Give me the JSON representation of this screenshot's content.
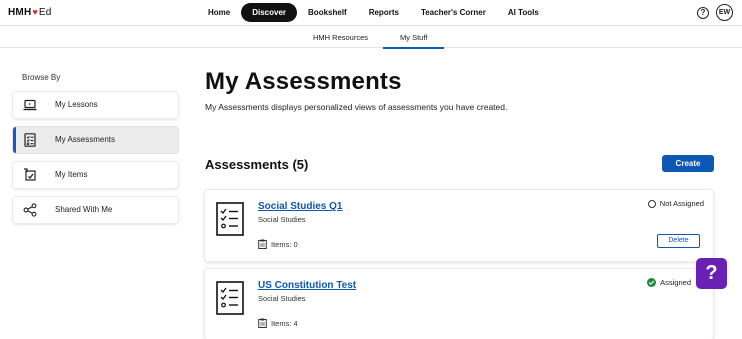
{
  "header": {
    "logo_text": "HMH",
    "logo_heart": "♥",
    "logo_suffix": "Ed",
    "nav": [
      "Home",
      "Discover",
      "Bookshelf",
      "Reports",
      "Teacher's Corner",
      "AI Tools"
    ],
    "active_nav": "Discover",
    "help_glyph": "?",
    "avatar_initials": "EW"
  },
  "subnav": {
    "tabs": [
      "HMH Resources",
      "My Stuff"
    ],
    "active_tab": "My Stuff"
  },
  "sidebar": {
    "title": "Browse By",
    "items": [
      {
        "label": "My Lessons",
        "icon": "laptop-icon"
      },
      {
        "label": "My Assessments",
        "icon": "checklist-icon",
        "active": true
      },
      {
        "label": "My Items",
        "icon": "items-icon"
      },
      {
        "label": "Shared With Me",
        "icon": "share-icon"
      }
    ]
  },
  "main": {
    "title": "My Assessments",
    "description": "My Assessments displays personalized views of assessments you have created.",
    "section_title": "Assessments (5)",
    "create_label": "Create",
    "cards": [
      {
        "title": "Social Studies Q1",
        "subject": "Social Studies",
        "items": "Items: 0",
        "status": "Not Assigned",
        "status_type": "not-assigned",
        "action": "Delete"
      },
      {
        "title": "US Constitution Test",
        "subject": "Social Studies",
        "items": "Items: 4",
        "status": "Assigned",
        "status_type": "assigned"
      }
    ]
  },
  "colors": {
    "accent": "#0d57b5",
    "active_nav_bg": "#111111",
    "assigned": "#1e8a3a",
    "help_fab": "#6a1fb5",
    "logo_heart": "#e3232a"
  },
  "help_fab_glyph": "?"
}
